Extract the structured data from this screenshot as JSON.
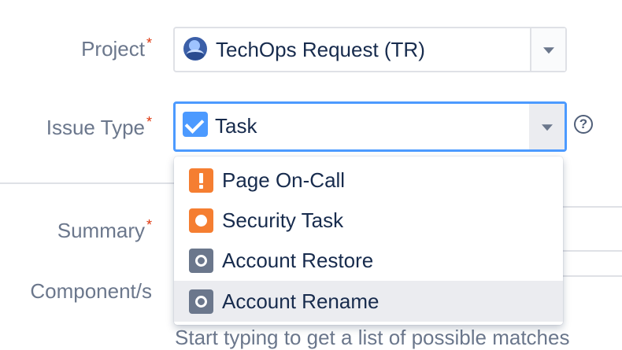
{
  "form": {
    "project": {
      "label": "Project",
      "required_mark": "*",
      "value": "TechOps Request (TR)",
      "avatar_icon": "project-avatar-icon"
    },
    "issue_type": {
      "label": "Issue Type",
      "required_mark": "*",
      "value": "Task",
      "icon": "task-checkbox-icon",
      "help_glyph": "?"
    },
    "summary": {
      "label": "Summary",
      "required_mark": "*"
    },
    "components": {
      "label": "Component/s",
      "hint_partial": "Start typing to get a list of possible matches"
    }
  },
  "dropdown": {
    "items": [
      {
        "label": "Page On-Call",
        "icon": "exclamation-icon",
        "color": "#f57e31"
      },
      {
        "label": "Security Task",
        "icon": "security-circle-icon",
        "color": "#f57e31"
      },
      {
        "label": "Account Restore",
        "icon": "account-icon",
        "color": "#6b778c"
      },
      {
        "label": "Account Rename",
        "icon": "account-icon",
        "color": "#6b778c",
        "highlighted": true
      }
    ]
  },
  "colors": {
    "focus": "#4c9aff",
    "label": "#6b778c",
    "required": "#de350b"
  }
}
